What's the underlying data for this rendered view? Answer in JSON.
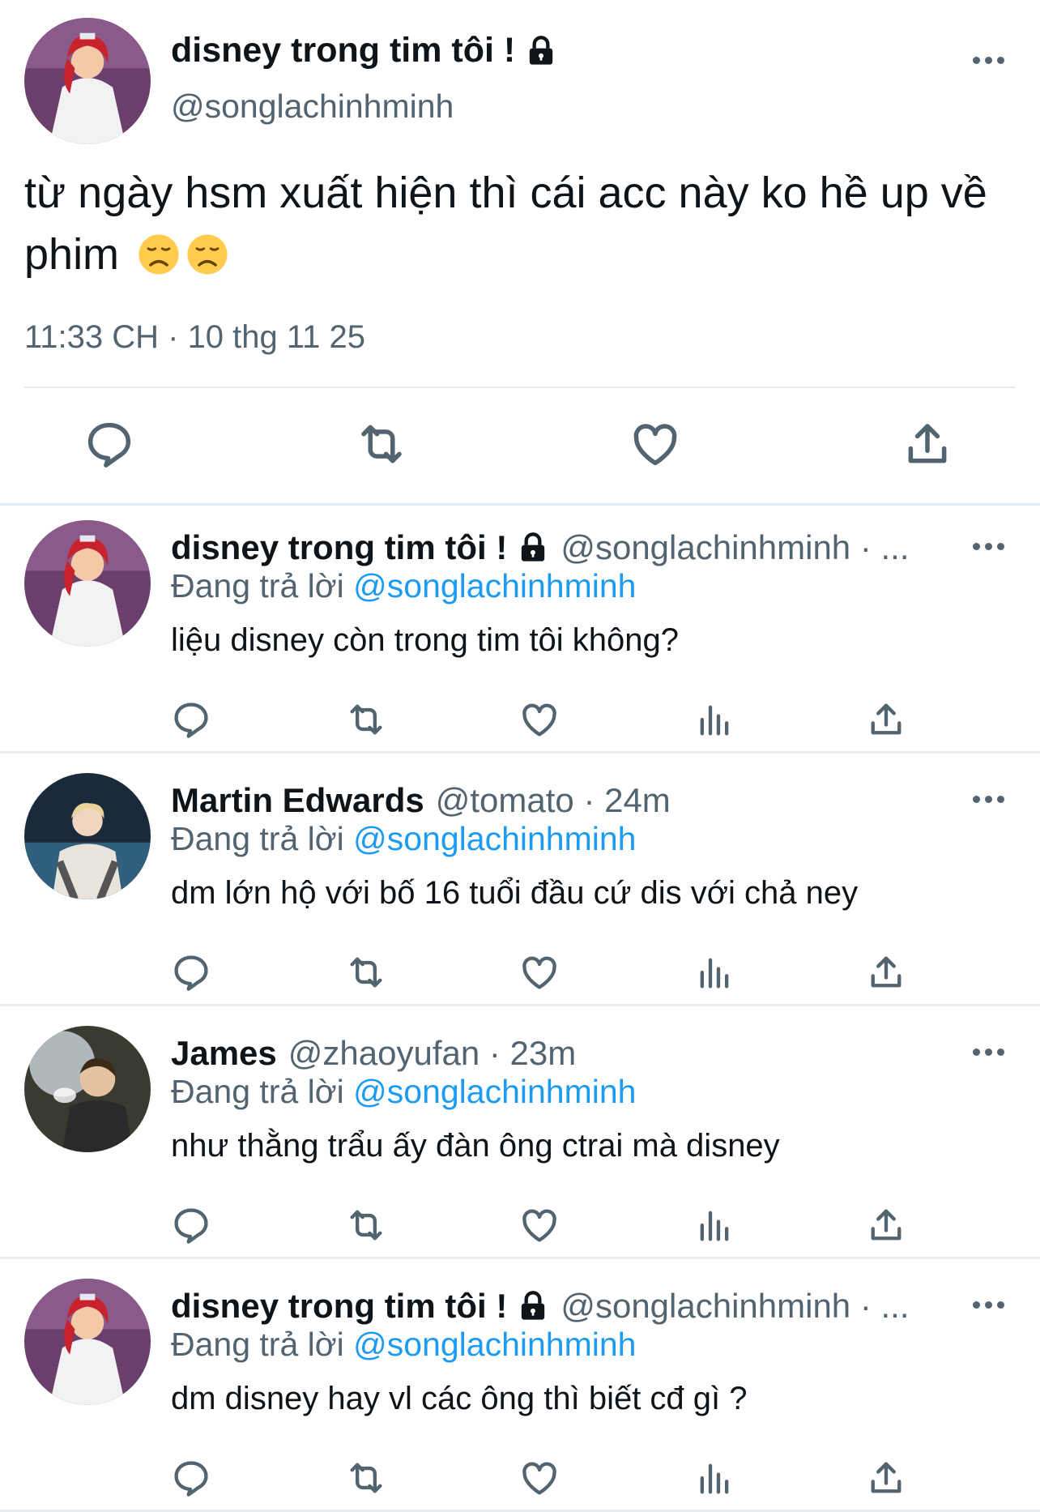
{
  "main_tweet": {
    "name": "disney trong tim tôi !",
    "handle": "@songlachinhminh",
    "text": "từ ngày hsm xuất hiện thì cái acc này ko hề up về phim",
    "emojis": [
      "disappointed-face",
      "disappointed-face"
    ],
    "timestamp": "11:33 CH · 10 thg 11 25",
    "actions": [
      "reply",
      "retweet",
      "like",
      "share"
    ]
  },
  "replying_to_label": "Đang trả lời",
  "replies": [
    {
      "name": "disney trong tim tôi !",
      "handle_meta": "@songlachinhminh · ...",
      "replying_to": "@songlachinhminh",
      "text": "liệu disney còn trong tim tôi không?",
      "locked": true,
      "avatar": "ariel"
    },
    {
      "name": "Martin Edwards",
      "handle_meta": "@tomato · 24m",
      "replying_to": "@songlachinhminh",
      "text": "dm lớn hộ với bố 16 tuổi đầu cứ dis với chả ney",
      "locked": false,
      "avatar": "martin"
    },
    {
      "name": "James",
      "handle_meta": "@zhaoyufan · 23m",
      "replying_to": "@songlachinhminh",
      "text": "như thằng trẩu ấy đàn ông ctrai mà disney",
      "locked": false,
      "avatar": "james"
    },
    {
      "name": "disney trong tim tôi !",
      "handle_meta": "@songlachinhminh · ...",
      "replying_to": "@songlachinhminh",
      "text": "dm disney hay vl các ông thì biết cđ gì ?",
      "locked": true,
      "avatar": "ariel"
    }
  ],
  "colors": {
    "text_primary": "#0f1419",
    "text_secondary": "#536471",
    "link": "#1d9bf0",
    "divider": "#e6ecf0"
  }
}
